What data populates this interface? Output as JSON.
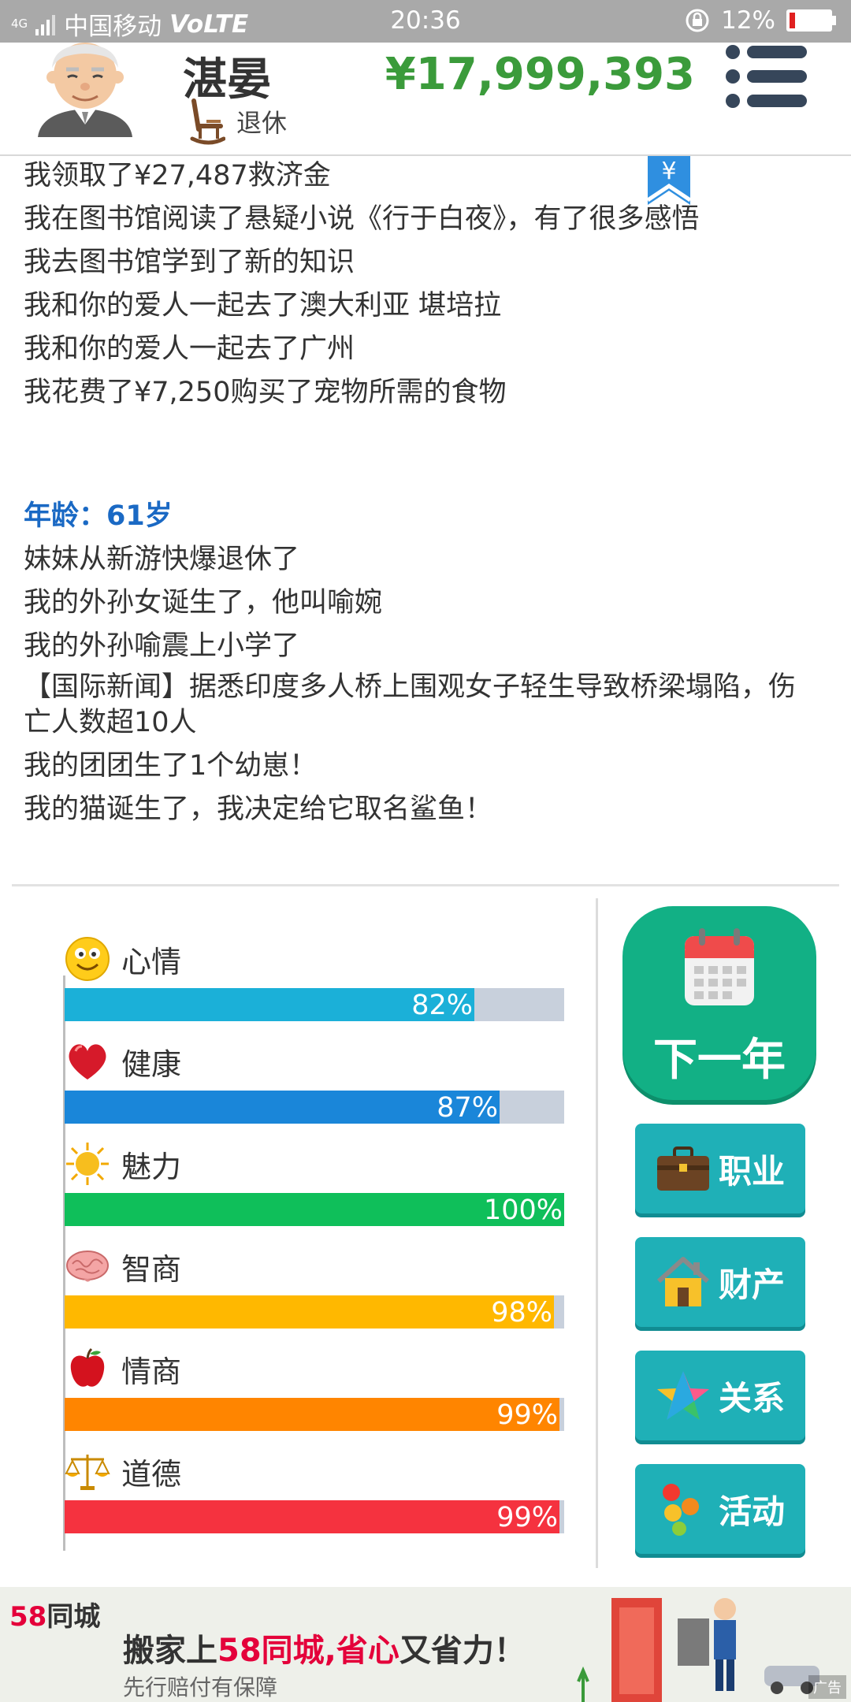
{
  "status_bar": {
    "network": "4G",
    "carrier": "中国移动",
    "volte": "VoLTE",
    "time": "20:36",
    "battery": "12%"
  },
  "header": {
    "name": "湛晏",
    "status": "退休",
    "money": "¥17,999,393"
  },
  "coin_tag": "¥",
  "log": {
    "lines_top": [
      "我领取了¥27,487救济金",
      "我在图书馆阅读了悬疑小说《行于白夜》，有了很多感悟",
      "我去图书馆学到了新的知识",
      "我和你的爱人一起去了澳大利亚 堪培拉",
      "我和你的爱人一起去了广州",
      "我花费了¥7,250购买了宠物所需的食物"
    ],
    "age_label": "年龄：61岁",
    "lines_bottom": [
      "妹妹从新游快爆退休了",
      "我的外孙女诞生了，他叫喻婉",
      "我的外孙喻震上小学了",
      "【国际新闻】据悉印度多人桥上围观女子轻生导致桥梁塌陷，伤亡人数超10人",
      "我的团团生了1个幼崽！",
      "我的猫诞生了，我决定给它取名鲨鱼！"
    ]
  },
  "stats": [
    {
      "label": "心情",
      "value": 82,
      "text": "82%",
      "color": "#1bb0d8",
      "icon": "smiley-icon"
    },
    {
      "label": "健康",
      "value": 87,
      "text": "87%",
      "color": "#1a86d9",
      "icon": "heart-icon"
    },
    {
      "label": "魅力",
      "value": 100,
      "text": "100%",
      "color": "#0fbf5a",
      "icon": "sun-icon"
    },
    {
      "label": "智商",
      "value": 98,
      "text": "98%",
      "color": "#ffb800",
      "icon": "brain-icon"
    },
    {
      "label": "情商",
      "value": 99,
      "text": "99%",
      "color": "#ff8500",
      "icon": "apple-icon"
    },
    {
      "label": "道德",
      "value": 99,
      "text": "99%",
      "color": "#f5323f",
      "icon": "scales-icon"
    }
  ],
  "buttons": {
    "next_year": "下一年",
    "career": "职业",
    "property": "财产",
    "relations": "关系",
    "activities": "活动"
  },
  "ad": {
    "brand_num": "58",
    "brand_name": "同城",
    "headline_a": "搬家上",
    "headline_b": "58同城,省心",
    "headline_c": "又省力！",
    "sub": "先行赔付有保障",
    "tag": "广告"
  },
  "colors": {
    "money": "#3b9b3b",
    "age": "#1a69c4",
    "next_year_bg": "#12b085",
    "button_bg": "#1fb0b7"
  }
}
